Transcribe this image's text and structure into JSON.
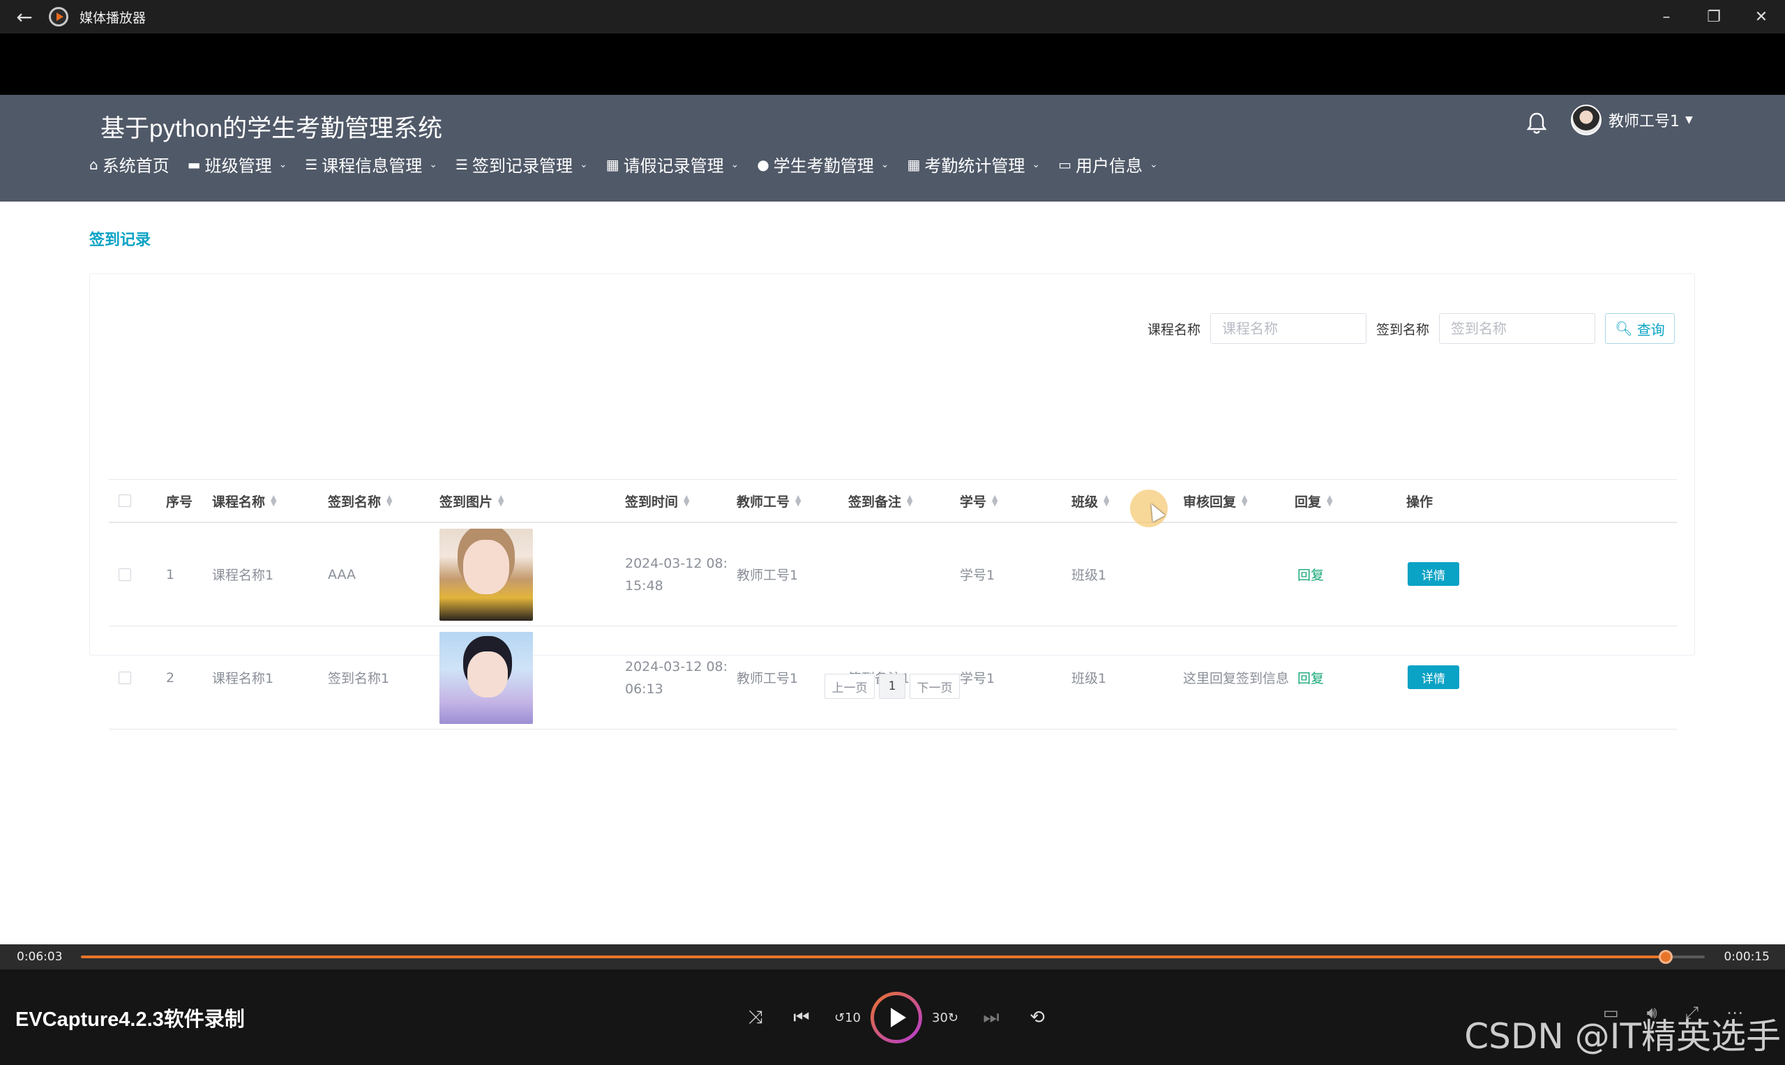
{
  "window": {
    "title": "媒体播放器",
    "back_icon": "arrow-left-icon",
    "app_icon": "media-player-icon",
    "controls": [
      "–",
      "❐",
      "✕"
    ]
  },
  "site": {
    "title": "基于python的学生考勤管理系统",
    "user": "教师工号1",
    "nav": [
      {
        "label": "系统首页",
        "icon": "home-icon",
        "glyph": "⌂",
        "dropdown": false
      },
      {
        "label": "班级管理",
        "icon": "briefcase-icon",
        "glyph": "▬",
        "dropdown": true
      },
      {
        "label": "课程信息管理",
        "icon": "list-icon",
        "glyph": "☰",
        "dropdown": true
      },
      {
        "label": "签到记录管理",
        "icon": "list-icon",
        "glyph": "☰",
        "dropdown": true
      },
      {
        "label": "请假记录管理",
        "icon": "grid-icon",
        "glyph": "▦",
        "dropdown": true
      },
      {
        "label": "学生考勤管理",
        "icon": "pin-icon",
        "glyph": "●",
        "dropdown": true
      },
      {
        "label": "考勤统计管理",
        "icon": "grid-icon",
        "glyph": "▦",
        "dropdown": true
      },
      {
        "label": "用户信息",
        "icon": "calendar-icon",
        "glyph": "▭",
        "dropdown": true
      }
    ]
  },
  "breadcrumb": "签到记录",
  "search": {
    "course_label": "课程名称",
    "course_placeholder": "课程名称",
    "signin_label": "签到名称",
    "signin_placeholder": "签到名称",
    "button": "查询"
  },
  "table": {
    "headers": {
      "index": "序号",
      "course": "课程名称",
      "signin": "签到名称",
      "photo": "签到图片",
      "time": "签到时间",
      "teacher": "教师工号",
      "remark": "签到备注",
      "student": "学号",
      "class": "班级",
      "review": "审核回复",
      "reply": "回复",
      "action": "操作"
    },
    "rows": [
      {
        "index": "1",
        "course": "课程名称1",
        "signin": "AAA",
        "time1": "2024-03-12 08:",
        "time2": "15:48",
        "teacher": "教师工号1",
        "remark": "",
        "student": "学号1",
        "class": "班级1",
        "review": "",
        "reply": "回复",
        "action": "详情"
      },
      {
        "index": "2",
        "course": "课程名称1",
        "signin": "签到名称1",
        "time1": "2024-03-12 08:",
        "time2": "06:13",
        "teacher": "教师工号1",
        "remark": "签到备注1",
        "student": "学号1",
        "class": "班级1",
        "review": "这里回复签到信息",
        "reply": "回复",
        "action": "详情"
      }
    ]
  },
  "pagination": {
    "prev": "上一页",
    "page": "1",
    "next": "下一页"
  },
  "player": {
    "elapsed": "0:06:03",
    "remaining": "0:00:15",
    "progress": 0.976,
    "title": "EVCapture4.2.3软件录制",
    "accent": "#e8742a",
    "controls": [
      "shuffle-icon",
      "previous-icon",
      "rewind-10-icon",
      "play-icon",
      "forward-30-icon",
      "next-icon",
      "repeat-off-icon"
    ],
    "watermark": "CSDN @IT精英选手"
  },
  "colors": {
    "header_bg": "#505968",
    "accent": "#0aa2c5",
    "reply": "#19a87a"
  }
}
